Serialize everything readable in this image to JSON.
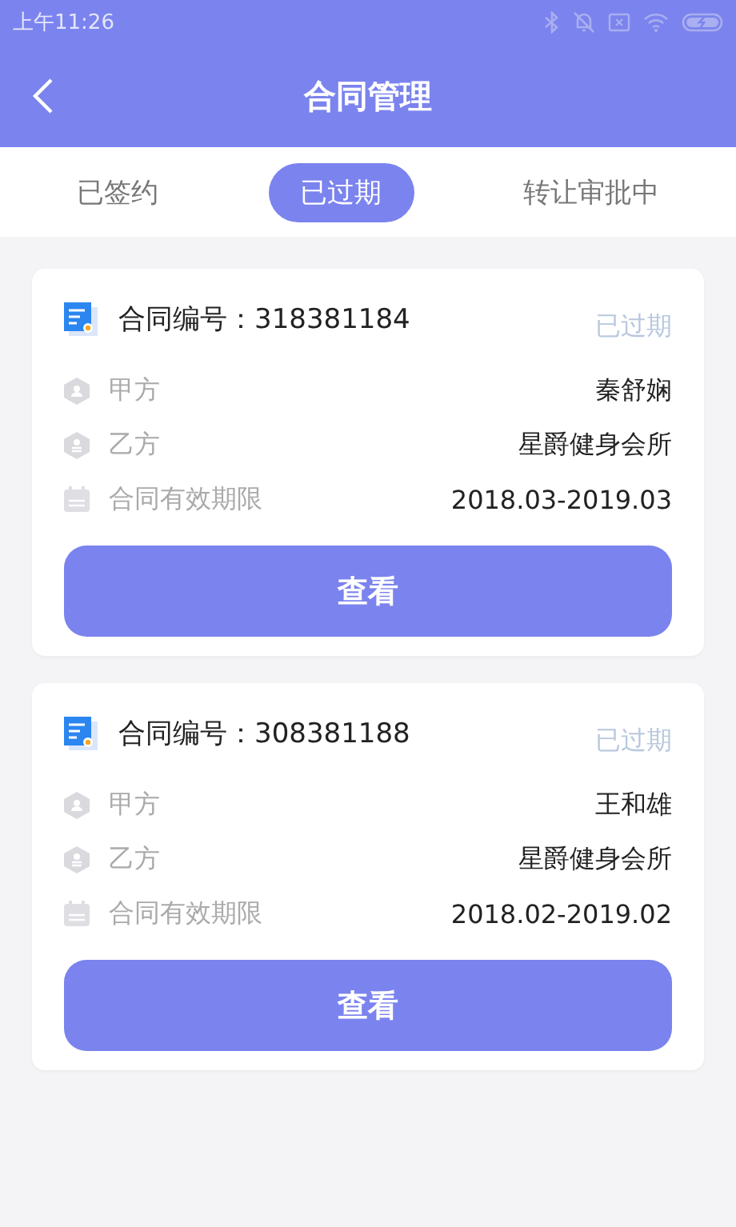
{
  "status_bar": {
    "time": "上午11:26"
  },
  "header": {
    "title": "合同管理"
  },
  "tabs": [
    {
      "label": "已签约",
      "selected": false
    },
    {
      "label": "已过期",
      "selected": true
    },
    {
      "label": "转让审批中",
      "selected": false
    }
  ],
  "contracts": [
    {
      "number_label": "合同编号：318381184",
      "status": "已过期",
      "rows": [
        {
          "kind": "party_a",
          "label": "甲方",
          "value": "秦舒娴"
        },
        {
          "kind": "party_b",
          "label": "乙方",
          "value": "星爵健身会所"
        },
        {
          "kind": "period",
          "label": "合同有效期限",
          "value": "2018.03-2019.03"
        }
      ],
      "button": "查看"
    },
    {
      "number_label": "合同编号：308381188",
      "status": "已过期",
      "rows": [
        {
          "kind": "party_a",
          "label": "甲方",
          "value": "王和雄"
        },
        {
          "kind": "party_b",
          "label": "乙方",
          "value": "星爵健身会所"
        },
        {
          "kind": "period",
          "label": "合同有效期限",
          "value": "2018.02-2019.02"
        }
      ],
      "button": "查看"
    }
  ]
}
